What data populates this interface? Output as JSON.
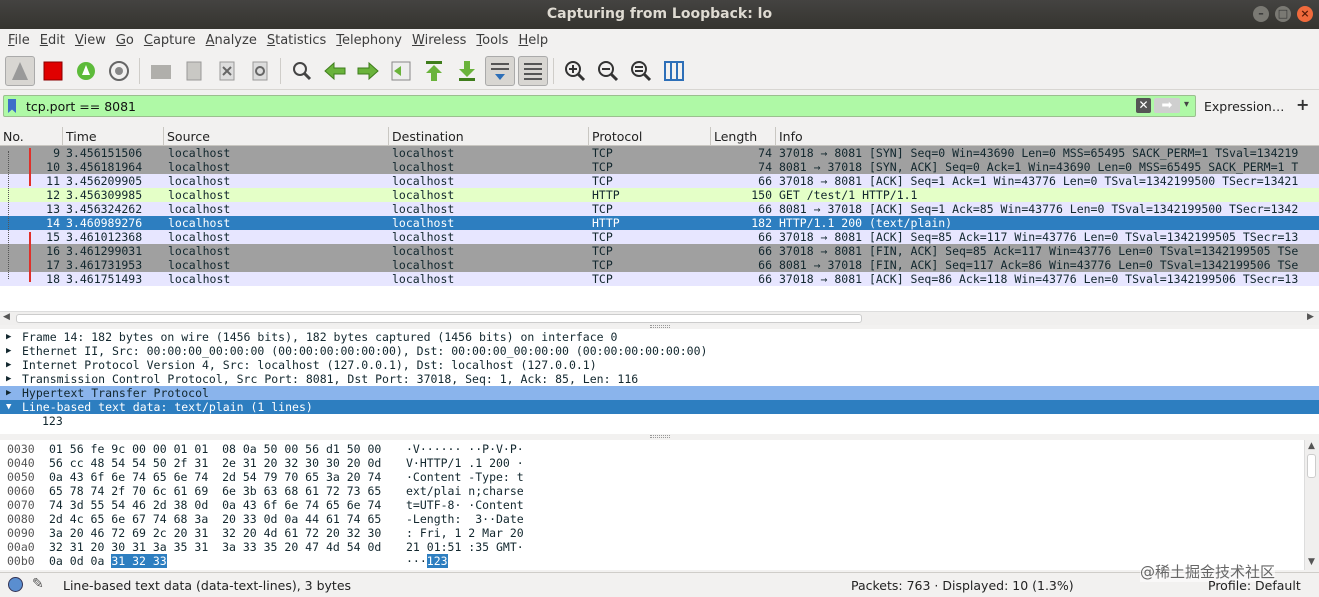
{
  "window": {
    "title": "Capturing from Loopback: lo"
  },
  "menu": [
    "File",
    "Edit",
    "View",
    "Go",
    "Capture",
    "Analyze",
    "Statistics",
    "Telephony",
    "Wireless",
    "Tools",
    "Help"
  ],
  "filter": {
    "value": "tcp.port == 8081",
    "expression_label": "Expression…",
    "plus_label": "+"
  },
  "columns": [
    "No.",
    "Time",
    "Source",
    "Destination",
    "Protocol",
    "Length",
    "Info"
  ],
  "packets": [
    {
      "no": "9",
      "time": "3.456151506",
      "src": "localhost",
      "dst": "localhost",
      "proto": "TCP",
      "len": "74",
      "info": "37018 → 8081 [SYN] Seq=0 Win=43690 Len=0 MSS=65495 SACK_PERM=1 TSval=134219",
      "style": "tcpgray"
    },
    {
      "no": "10",
      "time": "3.456181964",
      "src": "localhost",
      "dst": "localhost",
      "proto": "TCP",
      "len": "74",
      "info": "8081 → 37018 [SYN, ACK] Seq=0 Ack=1 Win=43690 Len=0 MSS=65495 SACK_PERM=1 T",
      "style": "tcpgray"
    },
    {
      "no": "11",
      "time": "3.456209905",
      "src": "localhost",
      "dst": "localhost",
      "proto": "TCP",
      "len": "66",
      "info": "37018 → 8081 [ACK] Seq=1 Ack=1 Win=43776 Len=0 TSval=1342199500 TSecr=13421",
      "style": "tcplight"
    },
    {
      "no": "12",
      "time": "3.456309985",
      "src": "localhost",
      "dst": "localhost",
      "proto": "HTTP",
      "len": "150",
      "info": "GET /test/1 HTTP/1.1",
      "style": "http"
    },
    {
      "no": "13",
      "time": "3.456324262",
      "src": "localhost",
      "dst": "localhost",
      "proto": "TCP",
      "len": "66",
      "info": "8081 → 37018 [ACK] Seq=1 Ack=85 Win=43776 Len=0 TSval=1342199500 TSecr=1342",
      "style": "tcplight"
    },
    {
      "no": "14",
      "time": "3.460989276",
      "src": "localhost",
      "dst": "localhost",
      "proto": "HTTP",
      "len": "182",
      "info": "HTTP/1.1 200   (text/plain)",
      "style": "sel"
    },
    {
      "no": "15",
      "time": "3.461012368",
      "src": "localhost",
      "dst": "localhost",
      "proto": "TCP",
      "len": "66",
      "info": "37018 → 8081 [ACK] Seq=85 Ack=117 Win=43776 Len=0 TSval=1342199505 TSecr=13",
      "style": "tcplight"
    },
    {
      "no": "16",
      "time": "3.461299031",
      "src": "localhost",
      "dst": "localhost",
      "proto": "TCP",
      "len": "66",
      "info": "37018 → 8081 [FIN, ACK] Seq=85 Ack=117 Win=43776 Len=0 TSval=1342199505 TSe",
      "style": "tcpgray"
    },
    {
      "no": "17",
      "time": "3.461731953",
      "src": "localhost",
      "dst": "localhost",
      "proto": "TCP",
      "len": "66",
      "info": "8081 → 37018 [FIN, ACK] Seq=117 Ack=86 Win=43776 Len=0 TSval=1342199506 TSe",
      "style": "tcpgray"
    },
    {
      "no": "18",
      "time": "3.461751493",
      "src": "localhost",
      "dst": "localhost",
      "proto": "TCP",
      "len": "66",
      "info": "37018 → 8081 [ACK] Seq=86 Ack=118 Win=43776 Len=0 TSval=1342199506 TSecr=13",
      "style": "tcplight"
    }
  ],
  "details": [
    {
      "text": "Frame 14: 182 bytes on wire (1456 bits), 182 bytes captured (1456 bits) on interface 0",
      "state": "collapsed",
      "style": ""
    },
    {
      "text": "Ethernet II, Src: 00:00:00_00:00:00 (00:00:00:00:00:00), Dst: 00:00:00_00:00:00 (00:00:00:00:00:00)",
      "state": "collapsed",
      "style": ""
    },
    {
      "text": "Internet Protocol Version 4, Src: localhost (127.0.0.1), Dst: localhost (127.0.0.1)",
      "state": "collapsed",
      "style": ""
    },
    {
      "text": "Transmission Control Protocol, Src Port: 8081, Dst Port: 37018, Seq: 1, Ack: 85, Len: 116",
      "state": "collapsed",
      "style": ""
    },
    {
      "text": "Hypertext Transfer Protocol",
      "state": "collapsed",
      "style": "hl"
    },
    {
      "text": "Line-based text data: text/plain (1 lines)",
      "state": "expanded",
      "style": "sel"
    },
    {
      "text": "123",
      "state": "child",
      "style": ""
    }
  ],
  "bytes": [
    {
      "off": "0030",
      "hex": "01 56 fe 9c 00 00 01 01  08 0a 50 00 56 d1 50 00",
      "ascii": "·V······ ··P·V·P·"
    },
    {
      "off": "0040",
      "hex": "56 cc 48 54 54 50 2f 31  2e 31 20 32 30 30 20 0d",
      "ascii": "V·HTTP/1 .1 200 ·"
    },
    {
      "off": "0050",
      "hex": "0a 43 6f 6e 74 65 6e 74  2d 54 79 70 65 3a 20 74",
      "ascii": "·Content -Type: t"
    },
    {
      "off": "0060",
      "hex": "65 78 74 2f 70 6c 61 69  6e 3b 63 68 61 72 73 65",
      "ascii": "ext/plai n;charse"
    },
    {
      "off": "0070",
      "hex": "74 3d 55 54 46 2d 38 0d  0a 43 6f 6e 74 65 6e 74",
      "ascii": "t=UTF-8· ·Content"
    },
    {
      "off": "0080",
      "hex": "2d 4c 65 6e 67 74 68 3a  20 33 0d 0a 44 61 74 65",
      "ascii": "-Length:  3··Date"
    },
    {
      "off": "0090",
      "hex": "3a 20 46 72 69 2c 20 31  32 20 4d 61 72 20 32 30",
      "ascii": ": Fri, 1 2 Mar 20"
    },
    {
      "off": "00a0",
      "hex": "32 31 20 30 31 3a 35 31  3a 33 35 20 47 4d 54 0d",
      "ascii": "21 01:51 :35 GMT·"
    },
    {
      "off": "00b0",
      "hex_plain": "0a 0d 0a ",
      "hex_sel": "31 32 33",
      "ascii_plain": "···",
      "ascii_sel": "123"
    }
  ],
  "status": {
    "text": "Line-based text data (data-text-lines), 3 bytes",
    "packets": "Packets: 763 · Displayed: 10 (1.3%)",
    "profile": "Profile: Default"
  },
  "watermark": "@稀土掘金技术社区",
  "colors": {
    "selected": "#2d7ec0",
    "http_row": "#e4ffc7",
    "tcp_gray": "#a0a0a0",
    "tcp_light": "#e7e6ff",
    "filter_bg": "#aff9a6"
  }
}
